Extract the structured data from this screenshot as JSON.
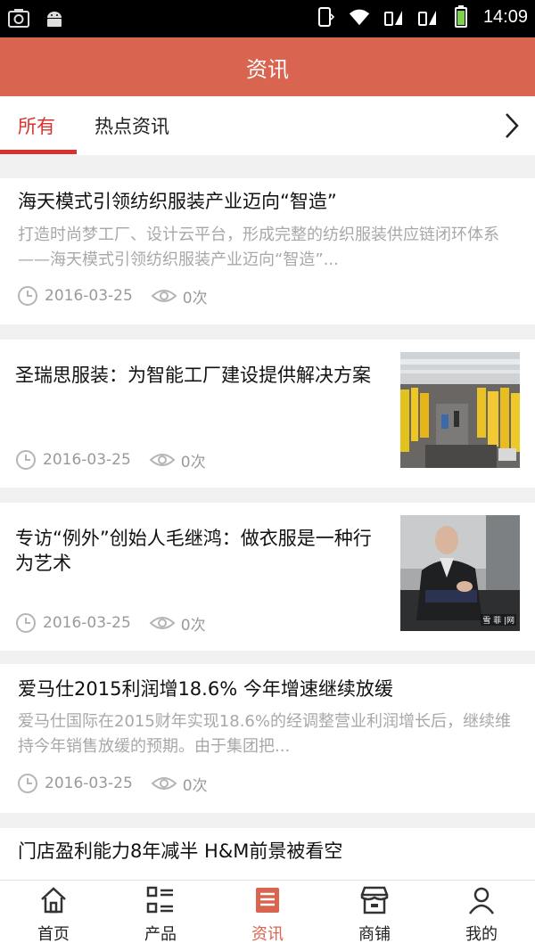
{
  "status_bar": {
    "time": "14:09"
  },
  "header": {
    "title": "资讯"
  },
  "tabs": [
    {
      "label": "所有",
      "active": true
    },
    {
      "label": "热点资讯",
      "active": false
    }
  ],
  "articles": [
    {
      "title": "海天模式引领纺织服装产业迈向“智造”",
      "summary": "打造时尚梦工厂、设计云平台，形成完整的纺织服装供应链闭环体系——海天模式引领纺织服装产业迈向“智造”...",
      "date": "2016-03-25",
      "views": "0次"
    },
    {
      "title": "圣瑞思服装：为智能工厂建设提供解决方案",
      "date": "2016-03-25",
      "views": "0次",
      "thumbnail": "factory-production-line-photo"
    },
    {
      "title": "专访“例外”创始人毛继鸿：做衣服是一种行为艺术",
      "date": "2016-03-25",
      "views": "0次",
      "thumbnail": "man-in-suit-seated-photo",
      "thumbnail_watermark": "雪 菲 |网"
    },
    {
      "title": "爱马仕2015利润增18.6% 今年增速继续放缓",
      "summary": "爱马仕国际在2015财年实现18.6%的经调整营业利润增长后，继续维持今年销售放缓的预期。由于集团把...",
      "date": "2016-03-25",
      "views": "0次"
    },
    {
      "title": "门店盈利能力8年减半 H&M前景被看空"
    }
  ],
  "bottom_nav": [
    {
      "label": "首页",
      "icon": "home-icon",
      "active": false
    },
    {
      "label": "产品",
      "icon": "product-list-icon",
      "active": false
    },
    {
      "label": "资讯",
      "icon": "news-icon",
      "active": true
    },
    {
      "label": "商铺",
      "icon": "shop-icon",
      "active": false
    },
    {
      "label": "我的",
      "icon": "profile-icon",
      "active": false
    }
  ],
  "colors": {
    "header_bg": "#d9644f",
    "tab_active": "#d8322f",
    "accent": "#d9644f"
  }
}
